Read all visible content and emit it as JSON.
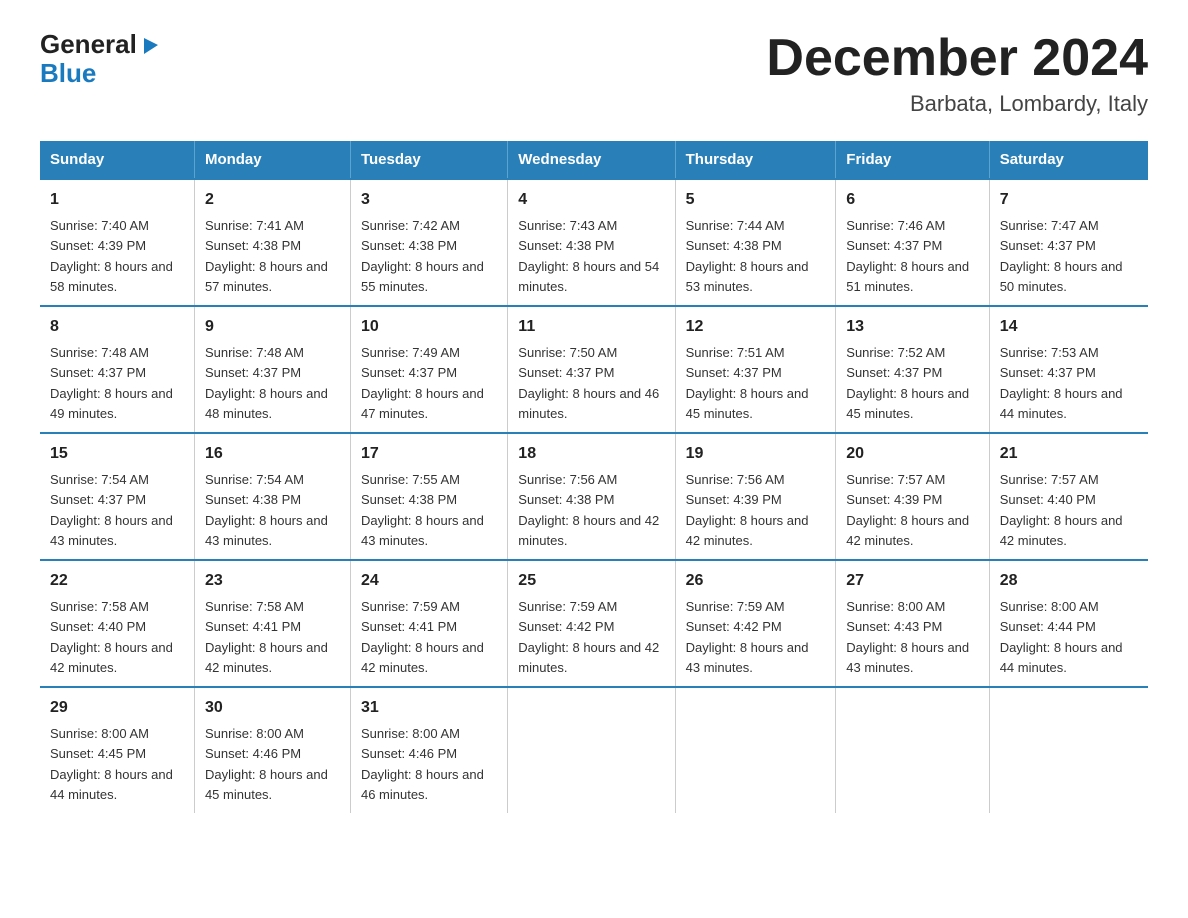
{
  "logo": {
    "general": "General",
    "blue": "Blue",
    "arrow": "▶"
  },
  "title": "December 2024",
  "subtitle": "Barbata, Lombardy, Italy",
  "weekdays": [
    "Sunday",
    "Monday",
    "Tuesday",
    "Wednesday",
    "Thursday",
    "Friday",
    "Saturday"
  ],
  "weeks": [
    [
      {
        "day": "1",
        "sunrise": "7:40 AM",
        "sunset": "4:39 PM",
        "daylight": "8 hours and 58 minutes."
      },
      {
        "day": "2",
        "sunrise": "7:41 AM",
        "sunset": "4:38 PM",
        "daylight": "8 hours and 57 minutes."
      },
      {
        "day": "3",
        "sunrise": "7:42 AM",
        "sunset": "4:38 PM",
        "daylight": "8 hours and 55 minutes."
      },
      {
        "day": "4",
        "sunrise": "7:43 AM",
        "sunset": "4:38 PM",
        "daylight": "8 hours and 54 minutes."
      },
      {
        "day": "5",
        "sunrise": "7:44 AM",
        "sunset": "4:38 PM",
        "daylight": "8 hours and 53 minutes."
      },
      {
        "day": "6",
        "sunrise": "7:46 AM",
        "sunset": "4:37 PM",
        "daylight": "8 hours and 51 minutes."
      },
      {
        "day": "7",
        "sunrise": "7:47 AM",
        "sunset": "4:37 PM",
        "daylight": "8 hours and 50 minutes."
      }
    ],
    [
      {
        "day": "8",
        "sunrise": "7:48 AM",
        "sunset": "4:37 PM",
        "daylight": "8 hours and 49 minutes."
      },
      {
        "day": "9",
        "sunrise": "7:48 AM",
        "sunset": "4:37 PM",
        "daylight": "8 hours and 48 minutes."
      },
      {
        "day": "10",
        "sunrise": "7:49 AM",
        "sunset": "4:37 PM",
        "daylight": "8 hours and 47 minutes."
      },
      {
        "day": "11",
        "sunrise": "7:50 AM",
        "sunset": "4:37 PM",
        "daylight": "8 hours and 46 minutes."
      },
      {
        "day": "12",
        "sunrise": "7:51 AM",
        "sunset": "4:37 PM",
        "daylight": "8 hours and 45 minutes."
      },
      {
        "day": "13",
        "sunrise": "7:52 AM",
        "sunset": "4:37 PM",
        "daylight": "8 hours and 45 minutes."
      },
      {
        "day": "14",
        "sunrise": "7:53 AM",
        "sunset": "4:37 PM",
        "daylight": "8 hours and 44 minutes."
      }
    ],
    [
      {
        "day": "15",
        "sunrise": "7:54 AM",
        "sunset": "4:37 PM",
        "daylight": "8 hours and 43 minutes."
      },
      {
        "day": "16",
        "sunrise": "7:54 AM",
        "sunset": "4:38 PM",
        "daylight": "8 hours and 43 minutes."
      },
      {
        "day": "17",
        "sunrise": "7:55 AM",
        "sunset": "4:38 PM",
        "daylight": "8 hours and 43 minutes."
      },
      {
        "day": "18",
        "sunrise": "7:56 AM",
        "sunset": "4:38 PM",
        "daylight": "8 hours and 42 minutes."
      },
      {
        "day": "19",
        "sunrise": "7:56 AM",
        "sunset": "4:39 PM",
        "daylight": "8 hours and 42 minutes."
      },
      {
        "day": "20",
        "sunrise": "7:57 AM",
        "sunset": "4:39 PM",
        "daylight": "8 hours and 42 minutes."
      },
      {
        "day": "21",
        "sunrise": "7:57 AM",
        "sunset": "4:40 PM",
        "daylight": "8 hours and 42 minutes."
      }
    ],
    [
      {
        "day": "22",
        "sunrise": "7:58 AM",
        "sunset": "4:40 PM",
        "daylight": "8 hours and 42 minutes."
      },
      {
        "day": "23",
        "sunrise": "7:58 AM",
        "sunset": "4:41 PM",
        "daylight": "8 hours and 42 minutes."
      },
      {
        "day": "24",
        "sunrise": "7:59 AM",
        "sunset": "4:41 PM",
        "daylight": "8 hours and 42 minutes."
      },
      {
        "day": "25",
        "sunrise": "7:59 AM",
        "sunset": "4:42 PM",
        "daylight": "8 hours and 42 minutes."
      },
      {
        "day": "26",
        "sunrise": "7:59 AM",
        "sunset": "4:42 PM",
        "daylight": "8 hours and 43 minutes."
      },
      {
        "day": "27",
        "sunrise": "8:00 AM",
        "sunset": "4:43 PM",
        "daylight": "8 hours and 43 minutes."
      },
      {
        "day": "28",
        "sunrise": "8:00 AM",
        "sunset": "4:44 PM",
        "daylight": "8 hours and 44 minutes."
      }
    ],
    [
      {
        "day": "29",
        "sunrise": "8:00 AM",
        "sunset": "4:45 PM",
        "daylight": "8 hours and 44 minutes."
      },
      {
        "day": "30",
        "sunrise": "8:00 AM",
        "sunset": "4:46 PM",
        "daylight": "8 hours and 45 minutes."
      },
      {
        "day": "31",
        "sunrise": "8:00 AM",
        "sunset": "4:46 PM",
        "daylight": "8 hours and 46 minutes."
      },
      null,
      null,
      null,
      null
    ]
  ]
}
